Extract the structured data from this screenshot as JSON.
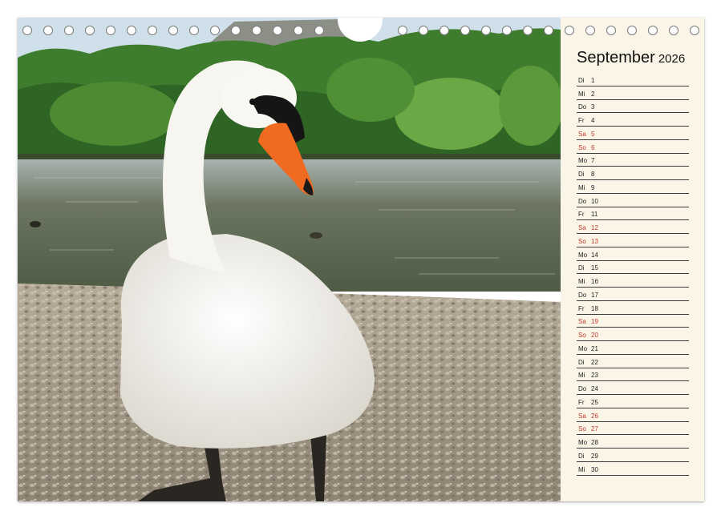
{
  "calendar": {
    "month": "September",
    "year": "2026",
    "weekend_color": "#c0392b",
    "days": [
      {
        "wd": "Di",
        "d": "1",
        "weekend": false
      },
      {
        "wd": "Mi",
        "d": "2",
        "weekend": false
      },
      {
        "wd": "Do",
        "d": "3",
        "weekend": false
      },
      {
        "wd": "Fr",
        "d": "4",
        "weekend": false
      },
      {
        "wd": "Sa",
        "d": "5",
        "weekend": true
      },
      {
        "wd": "So",
        "d": "6",
        "weekend": true
      },
      {
        "wd": "Mo",
        "d": "7",
        "weekend": false
      },
      {
        "wd": "Di",
        "d": "8",
        "weekend": false
      },
      {
        "wd": "Mi",
        "d": "9",
        "weekend": false
      },
      {
        "wd": "Do",
        "d": "10",
        "weekend": false
      },
      {
        "wd": "Fr",
        "d": "11",
        "weekend": false
      },
      {
        "wd": "Sa",
        "d": "12",
        "weekend": true
      },
      {
        "wd": "So",
        "d": "13",
        "weekend": true
      },
      {
        "wd": "Mo",
        "d": "14",
        "weekend": false
      },
      {
        "wd": "Di",
        "d": "15",
        "weekend": false
      },
      {
        "wd": "Mi",
        "d": "16",
        "weekend": false
      },
      {
        "wd": "Do",
        "d": "17",
        "weekend": false
      },
      {
        "wd": "Fr",
        "d": "18",
        "weekend": false
      },
      {
        "wd": "Sa",
        "d": "19",
        "weekend": true
      },
      {
        "wd": "So",
        "d": "20",
        "weekend": true
      },
      {
        "wd": "Mo",
        "d": "21",
        "weekend": false
      },
      {
        "wd": "Di",
        "d": "22",
        "weekend": false
      },
      {
        "wd": "Mi",
        "d": "23",
        "weekend": false
      },
      {
        "wd": "Do",
        "d": "24",
        "weekend": false
      },
      {
        "wd": "Fr",
        "d": "25",
        "weekend": false
      },
      {
        "wd": "Sa",
        "d": "26",
        "weekend": true
      },
      {
        "wd": "So",
        "d": "27",
        "weekend": true
      },
      {
        "wd": "Mo",
        "d": "28",
        "weekend": false
      },
      {
        "wd": "Di",
        "d": "29",
        "weekend": false
      },
      {
        "wd": "Mi",
        "d": "30",
        "weekend": false
      }
    ]
  },
  "photo": {
    "subject": "swan-photo",
    "colors": {
      "sky": "#cfe0ea",
      "forest": "#3f7d2e",
      "water": "#5d6a4f",
      "pebbles": "#a89c8a",
      "swan": "#f4f2ec",
      "beak": "#f06a1f"
    }
  },
  "binding": {
    "hole_count": 33
  }
}
